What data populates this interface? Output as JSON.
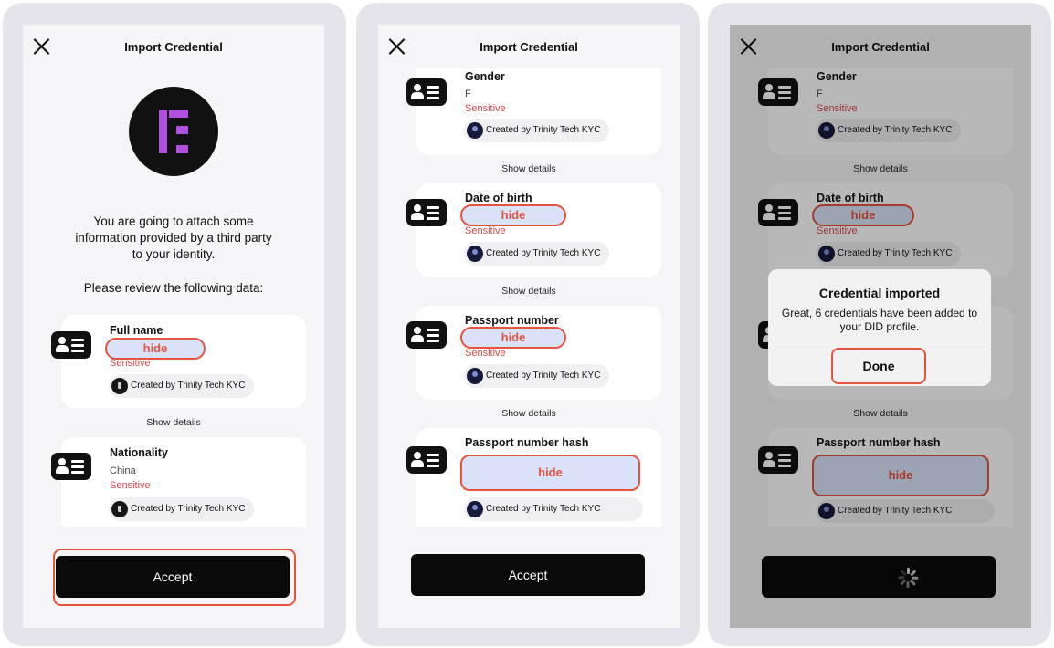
{
  "phones": [
    {
      "title": "Import Credential",
      "intro": "You are going to attach some\ninformation provided by a third party\nto your identity.",
      "review": "Please review the following data:",
      "cards": [
        {
          "title": "Full name",
          "hide": "hide",
          "sensitive": "Sensitive",
          "creator": "Created by Trinity Tech KYC"
        },
        {
          "title": "Nationality",
          "value": "China",
          "sensitive": "Sensitive",
          "creator": "Created by Trinity Tech KYC"
        }
      ],
      "show_details": "Show details",
      "accept": "Accept"
    },
    {
      "title": "Import Credential",
      "cards": [
        {
          "title": "Gender",
          "value": "F",
          "sensitive": "Sensitive",
          "creator": "Created by Trinity Tech KYC"
        },
        {
          "title": "Date of birth",
          "hide": "hide",
          "sensitive": "Sensitive",
          "creator": "Created by Trinity Tech KYC"
        },
        {
          "title": "Passport number",
          "hide": "hide",
          "sensitive": "Sensitive",
          "creator": "Created by Trinity Tech KYC"
        },
        {
          "title": "Passport number hash",
          "hide": "hide",
          "creator": "Created by Trinity Tech KYC"
        }
      ],
      "show_details": "Show details",
      "accept": "Accept"
    },
    {
      "title": "Import Credential",
      "cards": [
        {
          "title": "Gender",
          "value": "F",
          "sensitive": "Sensitive",
          "creator": "Created by Trinity Tech KYC"
        },
        {
          "title": "Date of birth",
          "hide": "hide",
          "sensitive": "Sensitive",
          "creator": "Created by Trinity Tech KYC"
        },
        {
          "title": "Passport number hash",
          "hide": "hide",
          "creator": "Created by Trinity Tech KYC"
        }
      ],
      "show_details": "Show details",
      "dialog": {
        "title": "Credential imported",
        "message": "Great, 6 credentials have been added to your DID profile.",
        "done": "Done"
      }
    }
  ],
  "colors": {
    "accent": "#e5533c",
    "sensitive": "#d4494b",
    "hide_fill": "#d9e2f8",
    "logo_purple": "#b04fe0",
    "button": "#0a0a0a"
  }
}
